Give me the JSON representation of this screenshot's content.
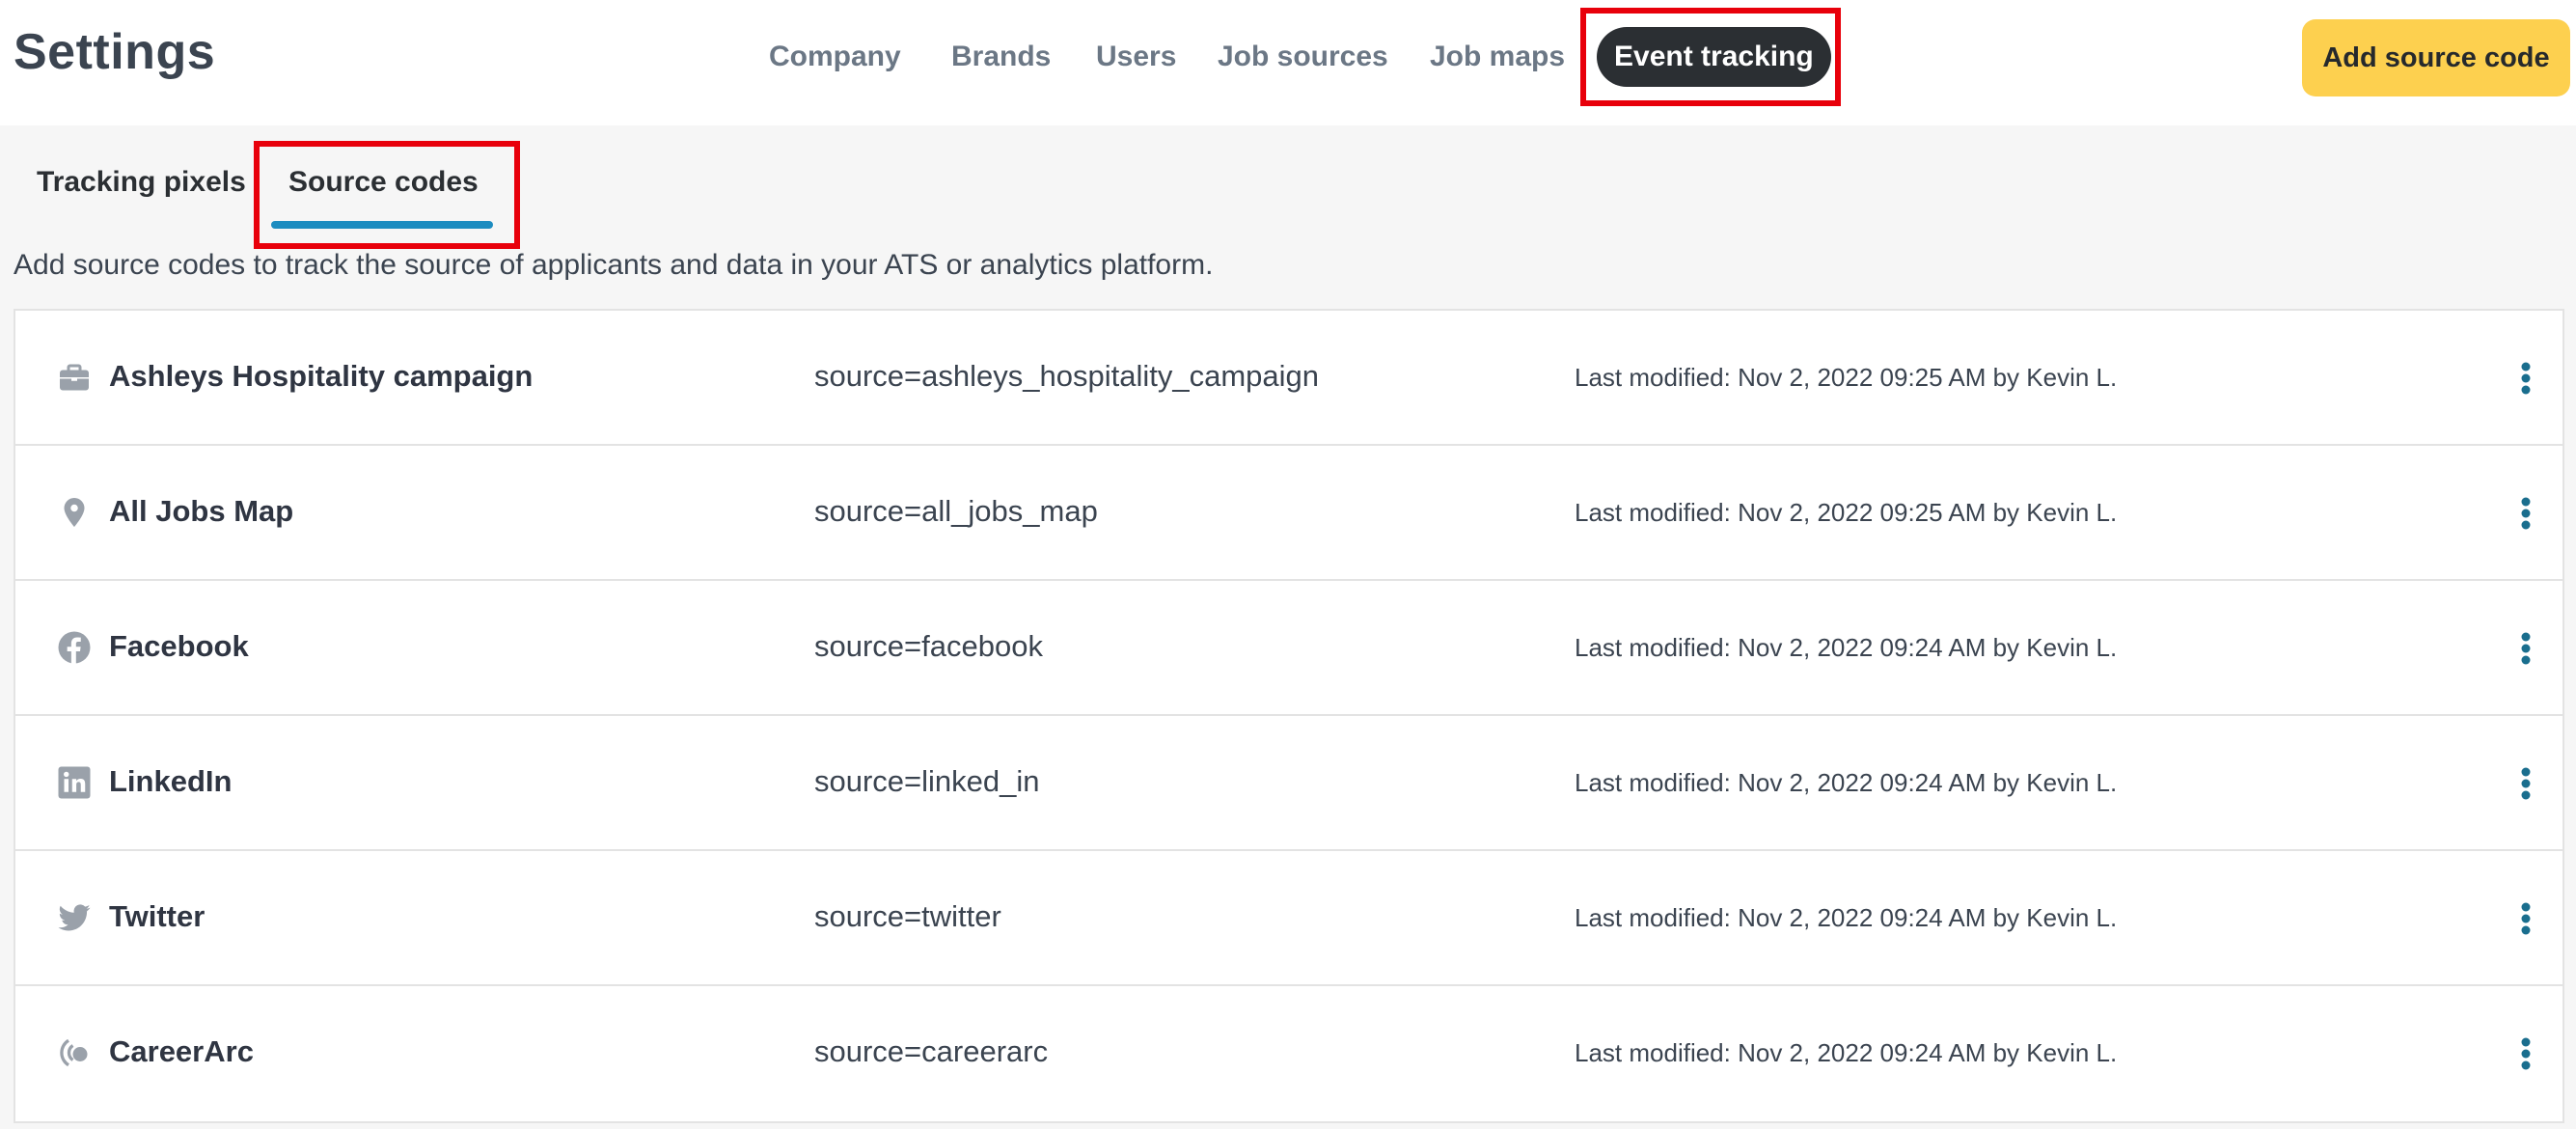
{
  "header": {
    "title": "Settings",
    "nav": [
      {
        "label": "Company"
      },
      {
        "label": "Brands"
      },
      {
        "label": "Users"
      },
      {
        "label": "Job sources"
      },
      {
        "label": "Job maps"
      },
      {
        "label": "Event tracking",
        "active": true
      }
    ],
    "add_button_label": "Add source code"
  },
  "subtabs": [
    {
      "label": "Tracking pixels"
    },
    {
      "label": "Source codes",
      "active": true
    }
  ],
  "description": "Add source codes to track the source of applicants and data in your ATS or analytics platform.",
  "colors": {
    "accent_yellow": "#fdd04f",
    "active_nav_bg": "#2b2f33",
    "subtab_underline": "#1c8cc0",
    "highlight_red": "#e8000b",
    "menu_icon": "#1a6e8e"
  },
  "source_codes": [
    {
      "icon": "briefcase-icon",
      "name": "Ashleys Hospitality campaign",
      "code": "source=ashleys_hospitality_campaign",
      "modified": "Last modified: Nov 2, 2022 09:25 AM by Kevin L."
    },
    {
      "icon": "map-pin-icon",
      "name": "All Jobs Map",
      "code": "source=all_jobs_map",
      "modified": "Last modified: Nov 2, 2022 09:25 AM by Kevin L."
    },
    {
      "icon": "facebook-icon",
      "name": "Facebook",
      "code": "source=facebook",
      "modified": "Last modified: Nov 2, 2022 09:24 AM by Kevin L."
    },
    {
      "icon": "linkedin-icon",
      "name": "LinkedIn",
      "code": "source=linked_in",
      "modified": "Last modified: Nov 2, 2022 09:24 AM by Kevin L."
    },
    {
      "icon": "twitter-icon",
      "name": "Twitter",
      "code": "source=twitter",
      "modified": "Last modified: Nov 2, 2022 09:24 AM by Kevin L."
    },
    {
      "icon": "careerarc-icon",
      "name": "CareerArc",
      "code": "source=careerarc",
      "modified": "Last modified: Nov 2, 2022 09:24 AM by Kevin L."
    }
  ]
}
